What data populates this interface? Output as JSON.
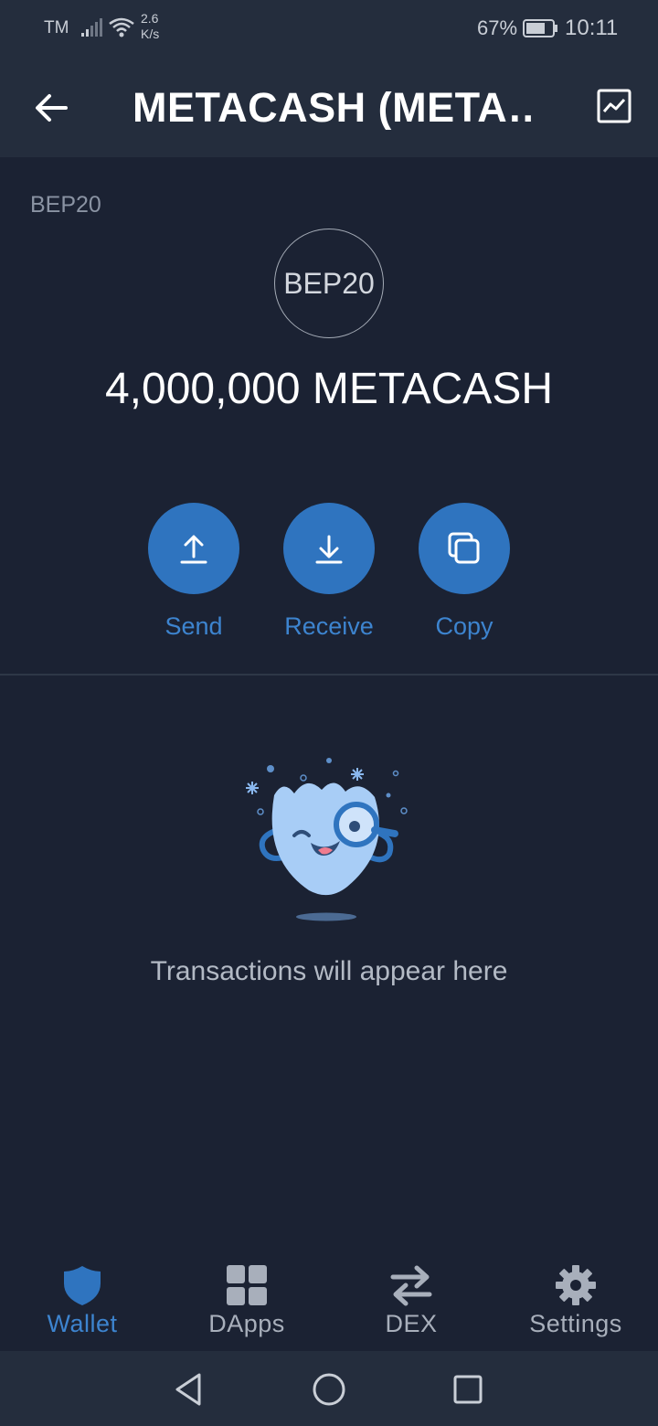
{
  "status_bar": {
    "carrier": "TM",
    "net_speed_value": "2.6",
    "net_speed_unit": "K/s",
    "battery": "67%",
    "time": "10:11"
  },
  "app_bar": {
    "title": "METACASH (META…",
    "back_icon": "arrow-left-icon",
    "chart_icon": "price-chart-icon"
  },
  "token": {
    "network": "BEP20",
    "badge_text": "BEP20",
    "balance": "4,000,000 METACASH"
  },
  "actions": [
    {
      "label": "Send",
      "icon": "arrow-up-icon"
    },
    {
      "label": "Receive",
      "icon": "arrow-down-icon"
    },
    {
      "label": "Copy",
      "icon": "copy-icon"
    }
  ],
  "empty_state": {
    "message": "Transactions will appear here",
    "illustration": "searching-mascot"
  },
  "bottom_nav": [
    {
      "label": "Wallet",
      "icon": "shield-icon",
      "active": true
    },
    {
      "label": "DApps",
      "icon": "grid-icon",
      "active": false
    },
    {
      "label": "DEX",
      "icon": "swap-arrows-icon",
      "active": false
    },
    {
      "label": "Settings",
      "icon": "gear-icon",
      "active": false
    }
  ],
  "colors": {
    "background": "#1b2233",
    "bar": "#242d3d",
    "accent": "#2f74bf",
    "accent_text": "#3d84cf"
  }
}
